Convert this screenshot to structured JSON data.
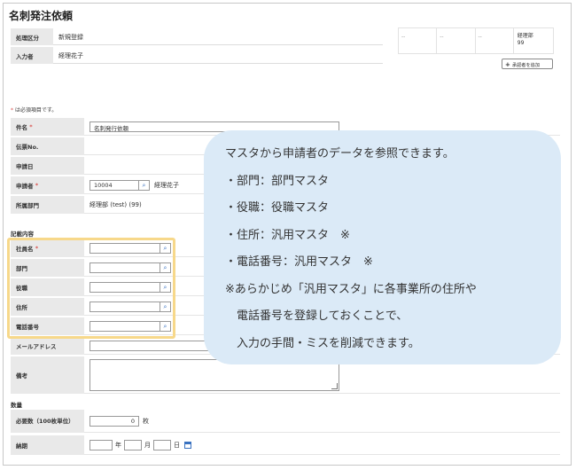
{
  "page": {
    "title": "名刺発注依頼"
  },
  "header": {
    "rows": [
      {
        "label": "処理区分",
        "value": "新規登録"
      },
      {
        "label": "入力者",
        "value": "経理花子"
      }
    ],
    "approvers": [
      "--",
      "--",
      "--",
      "経理部\n99"
    ],
    "add_approver_label": "承認者を追加"
  },
  "required_note": {
    "mark": "*",
    "text": " は必須項目です。"
  },
  "fields": {
    "subject": {
      "label": "件名",
      "value": "名刺発行依頼"
    },
    "slip_no": {
      "label": "伝票No."
    },
    "apply_date": {
      "label": "申請日"
    },
    "applicant": {
      "label": "申請者",
      "code": "10004",
      "name": "経理花子"
    },
    "department": {
      "label": "所属部門",
      "value": "経理部 (test) (99)"
    }
  },
  "details": {
    "section_label": "記載内容",
    "rows": [
      {
        "label": "社員名",
        "required": true
      },
      {
        "label": "部門"
      },
      {
        "label": "役職"
      },
      {
        "label": "住所"
      },
      {
        "label": "電話番号"
      }
    ],
    "email_label": "メールアドレス",
    "remarks_label": "備考"
  },
  "quantity": {
    "section_label": "数量",
    "count_label": "必要数（100枚単位）",
    "count_value": "0",
    "count_unit": "枚",
    "delivery_label": "納期",
    "year_unit": "年",
    "month_unit": "月",
    "day_unit": "日"
  },
  "callout": {
    "lines": [
      "マスタから申請者のデータを参照できます。",
      "・部門：部門マスタ",
      "・役職：役職マスタ",
      "・住所：汎用マスタ　※",
      "・電話番号：汎用マスタ　※",
      "※あらかじめ「汎用マスタ」に各事業所の住所や",
      "　電話番号を登録しておくことで、",
      "　入力の手間・ミスを削減できます。"
    ]
  },
  "colors": {
    "highlight": "#f7d88a",
    "callout_bg": "#dbeaf7",
    "required": "#d9534f",
    "icon": "#3a72c0"
  }
}
